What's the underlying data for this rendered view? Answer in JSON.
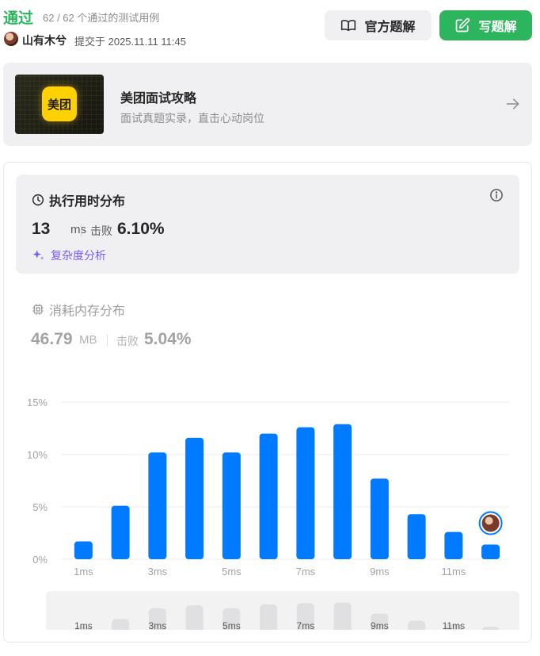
{
  "header": {
    "status": "通过",
    "case_count": "62 / 62 个通过的测试用例",
    "username": "山有木兮",
    "submit_time": "提交于 2025.11.11 11:45",
    "official_solution_label": "官方题解",
    "write_solution_label": "写题解"
  },
  "ad": {
    "logo_text": "美团",
    "title": "美团面试攻略",
    "subtitle": "面试真题实录，直击心动岗位"
  },
  "runtime": {
    "heading": "执行用时分布",
    "value": "13",
    "unit": "ms",
    "beats_label": "击败",
    "beats_value": "6.10%",
    "complexity_label": "复杂度分析"
  },
  "memory": {
    "heading": "消耗内存分布",
    "value": "46.79",
    "unit": "MB",
    "beats_label": "击败",
    "beats_value": "5.04%"
  },
  "colors": {
    "accent_green": "#2db55d",
    "bar_blue": "#007aff",
    "purple": "#7a5af8"
  },
  "chart_data": {
    "type": "bar",
    "categories": [
      "1ms",
      "2ms",
      "3ms",
      "4ms",
      "5ms",
      "6ms",
      "7ms",
      "8ms",
      "9ms",
      "10ms",
      "11ms",
      "12ms"
    ],
    "values": [
      1.7,
      5.1,
      10.2,
      11.6,
      10.2,
      12.0,
      12.6,
      12.9,
      7.7,
      4.3,
      2.6,
      1.4
    ],
    "ylim": [
      0,
      15
    ],
    "y_ticks": [
      "0%",
      "5%",
      "10%",
      "15%"
    ],
    "x_tick_labels": [
      "1ms",
      "3ms",
      "5ms",
      "7ms",
      "9ms",
      "11ms"
    ],
    "highlight_category": "12ms",
    "grid": true,
    "xlabel": "",
    "ylabel": ""
  },
  "mini_chart_labels": [
    "1ms",
    "3ms",
    "5ms",
    "7ms",
    "9ms",
    "11ms"
  ]
}
